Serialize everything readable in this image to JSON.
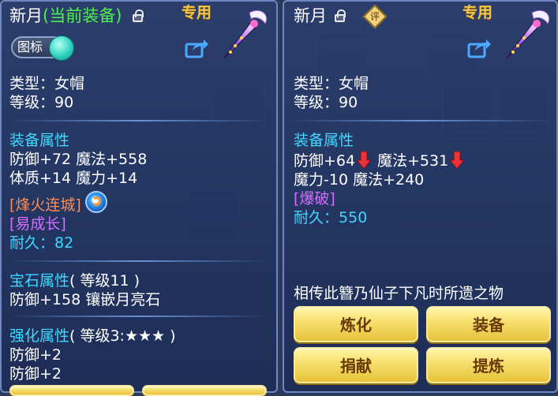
{
  "left": {
    "title": "新月",
    "title_status": "(当前装备)",
    "exclusive": "专用",
    "icon_toggle_label": "图标",
    "type_line": "类型：女帽",
    "level_line": "等级：90",
    "attr_header": "装备属性",
    "attr_lines": [
      "防御+72 魔法+558",
      "体质+14 魔力+14"
    ],
    "special_1": "[烽火连城]",
    "special_2": "[易成长]",
    "durability_label": "耐久：",
    "durability_value": "82",
    "gem_header": "宝石属性",
    "gem_level": "( 等级11 )",
    "gem_line": "防御+158 镶嵌月亮石",
    "enhance_header": "强化属性",
    "enhance_level": "( 等级3:★★★ )",
    "enhance_lines": [
      "防御+2",
      "防御+2"
    ]
  },
  "right": {
    "title": "新月",
    "badge": "评",
    "exclusive": "专用",
    "type_line": "类型：女帽",
    "level_line": "等级：90",
    "attr_header": "装备属性",
    "attr_line_1a": "防御+64",
    "attr_line_1b": "魔法+531",
    "attr_line_2": "魔力-10 魔法+240",
    "special_1": "[爆破]",
    "durability_label": "耐久：",
    "durability_value": "550",
    "description": "相传此簪乃仙子下凡时所遗之物",
    "buttons": [
      "炼化",
      "装备",
      "捐献",
      "提炼"
    ]
  },
  "colors": {
    "header_cyan": "#3fd8ff",
    "status_green": "#4ef04e",
    "button_gold": "#f6e070",
    "panel_blue": "#2c3e6e"
  },
  "icons": [
    "lock-icon",
    "share-icon",
    "weapon-hairpin-icon",
    "gem-icon",
    "down-arrow-icon",
    "rating-badge-icon"
  ]
}
